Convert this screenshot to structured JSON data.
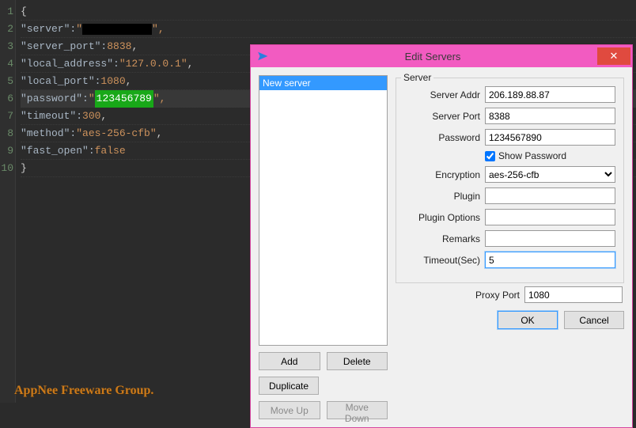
{
  "editor": {
    "line1": "{",
    "key_server": "\"server\":",
    "server_q1": " \"",
    "server_q2": "\",",
    "key_server_port": "\"server_port\":",
    "val_server_port": " 8838",
    "key_local_address": "\"local_address\":",
    "val_local_address": " \"127.0.0.1\"",
    "key_local_port": "\"local_port\":",
    "val_local_port": " 1080",
    "key_password": "\"password\":",
    "pw_q1": " \"",
    "pw_val": "123456789",
    "pw_q2": "\",",
    "key_timeout": "\"timeout\":",
    "val_timeout": " 300",
    "key_method": "\"method\":",
    "val_method": " \"aes-256-cfb\"",
    "key_fast_open": "\"fast_open\":",
    "val_fast_open": " false",
    "line10": "}",
    "comma": ","
  },
  "gutter": [
    "1",
    "2",
    "3",
    "4",
    "5",
    "6",
    "7",
    "8",
    "9",
    "10"
  ],
  "watermark": "AppNee Freeware Group.",
  "dialog": {
    "title": "Edit Servers",
    "list": {
      "items": [
        "New server"
      ],
      "selected": 0
    },
    "group_label": "Server",
    "labels": {
      "server_addr": "Server Addr",
      "server_port": "Server Port",
      "password": "Password",
      "show_password": "Show Password",
      "encryption": "Encryption",
      "plugin": "Plugin",
      "plugin_options": "Plugin Options",
      "remarks": "Remarks",
      "timeout": "Timeout(Sec)",
      "proxy_port": "Proxy Port"
    },
    "values": {
      "server_addr": "206.189.88.87",
      "server_port": "8388",
      "password": "1234567890",
      "show_password": true,
      "encryption": "aes-256-cfb",
      "plugin": "",
      "plugin_options": "",
      "remarks": "",
      "timeout": "5",
      "proxy_port": "1080"
    },
    "buttons": {
      "add": "Add",
      "delete": "Delete",
      "duplicate": "Duplicate",
      "move_up": "Move Up",
      "move_down": "Move Down",
      "ok": "OK",
      "cancel": "Cancel"
    }
  }
}
